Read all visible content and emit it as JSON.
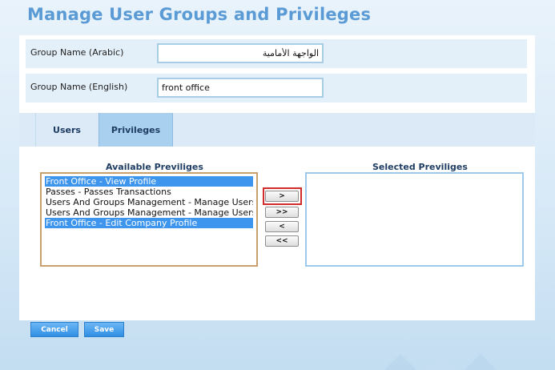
{
  "page": {
    "title": "Manage User Groups and Privileges"
  },
  "form": {
    "arabic_label": "Group Name (Arabic)",
    "arabic_value": "الواجهة الأمامية",
    "english_label": "Group Name (English)",
    "english_value": "front office"
  },
  "tabs": [
    {
      "label": "Users",
      "active": false
    },
    {
      "label": "Privileges",
      "active": true
    }
  ],
  "available": {
    "title": "Available Previliges",
    "items": [
      {
        "label": "Front Office - View Profile",
        "selected": true
      },
      {
        "label": "Passes - Passes Transactions",
        "selected": false
      },
      {
        "label": "Users And Groups Management - Manage Users And Groups",
        "selected": false
      },
      {
        "label": "Users And Groups Management - Manage Users And Groups",
        "selected": false
      },
      {
        "label": "Front Office - Edit Company Profile",
        "selected": true
      }
    ]
  },
  "selected": {
    "title": "Selected Previliges",
    "items": []
  },
  "move_buttons": {
    "add": ">",
    "add_all": ">>",
    "remove": "<",
    "remove_all": "<<"
  },
  "actions": {
    "cancel": "Cancel",
    "save": "Save"
  },
  "colors": {
    "title": "#5b9bd5",
    "selected_row": "#3d95ee",
    "highlight": "#d12b2b",
    "button": "#2f8fe3"
  }
}
